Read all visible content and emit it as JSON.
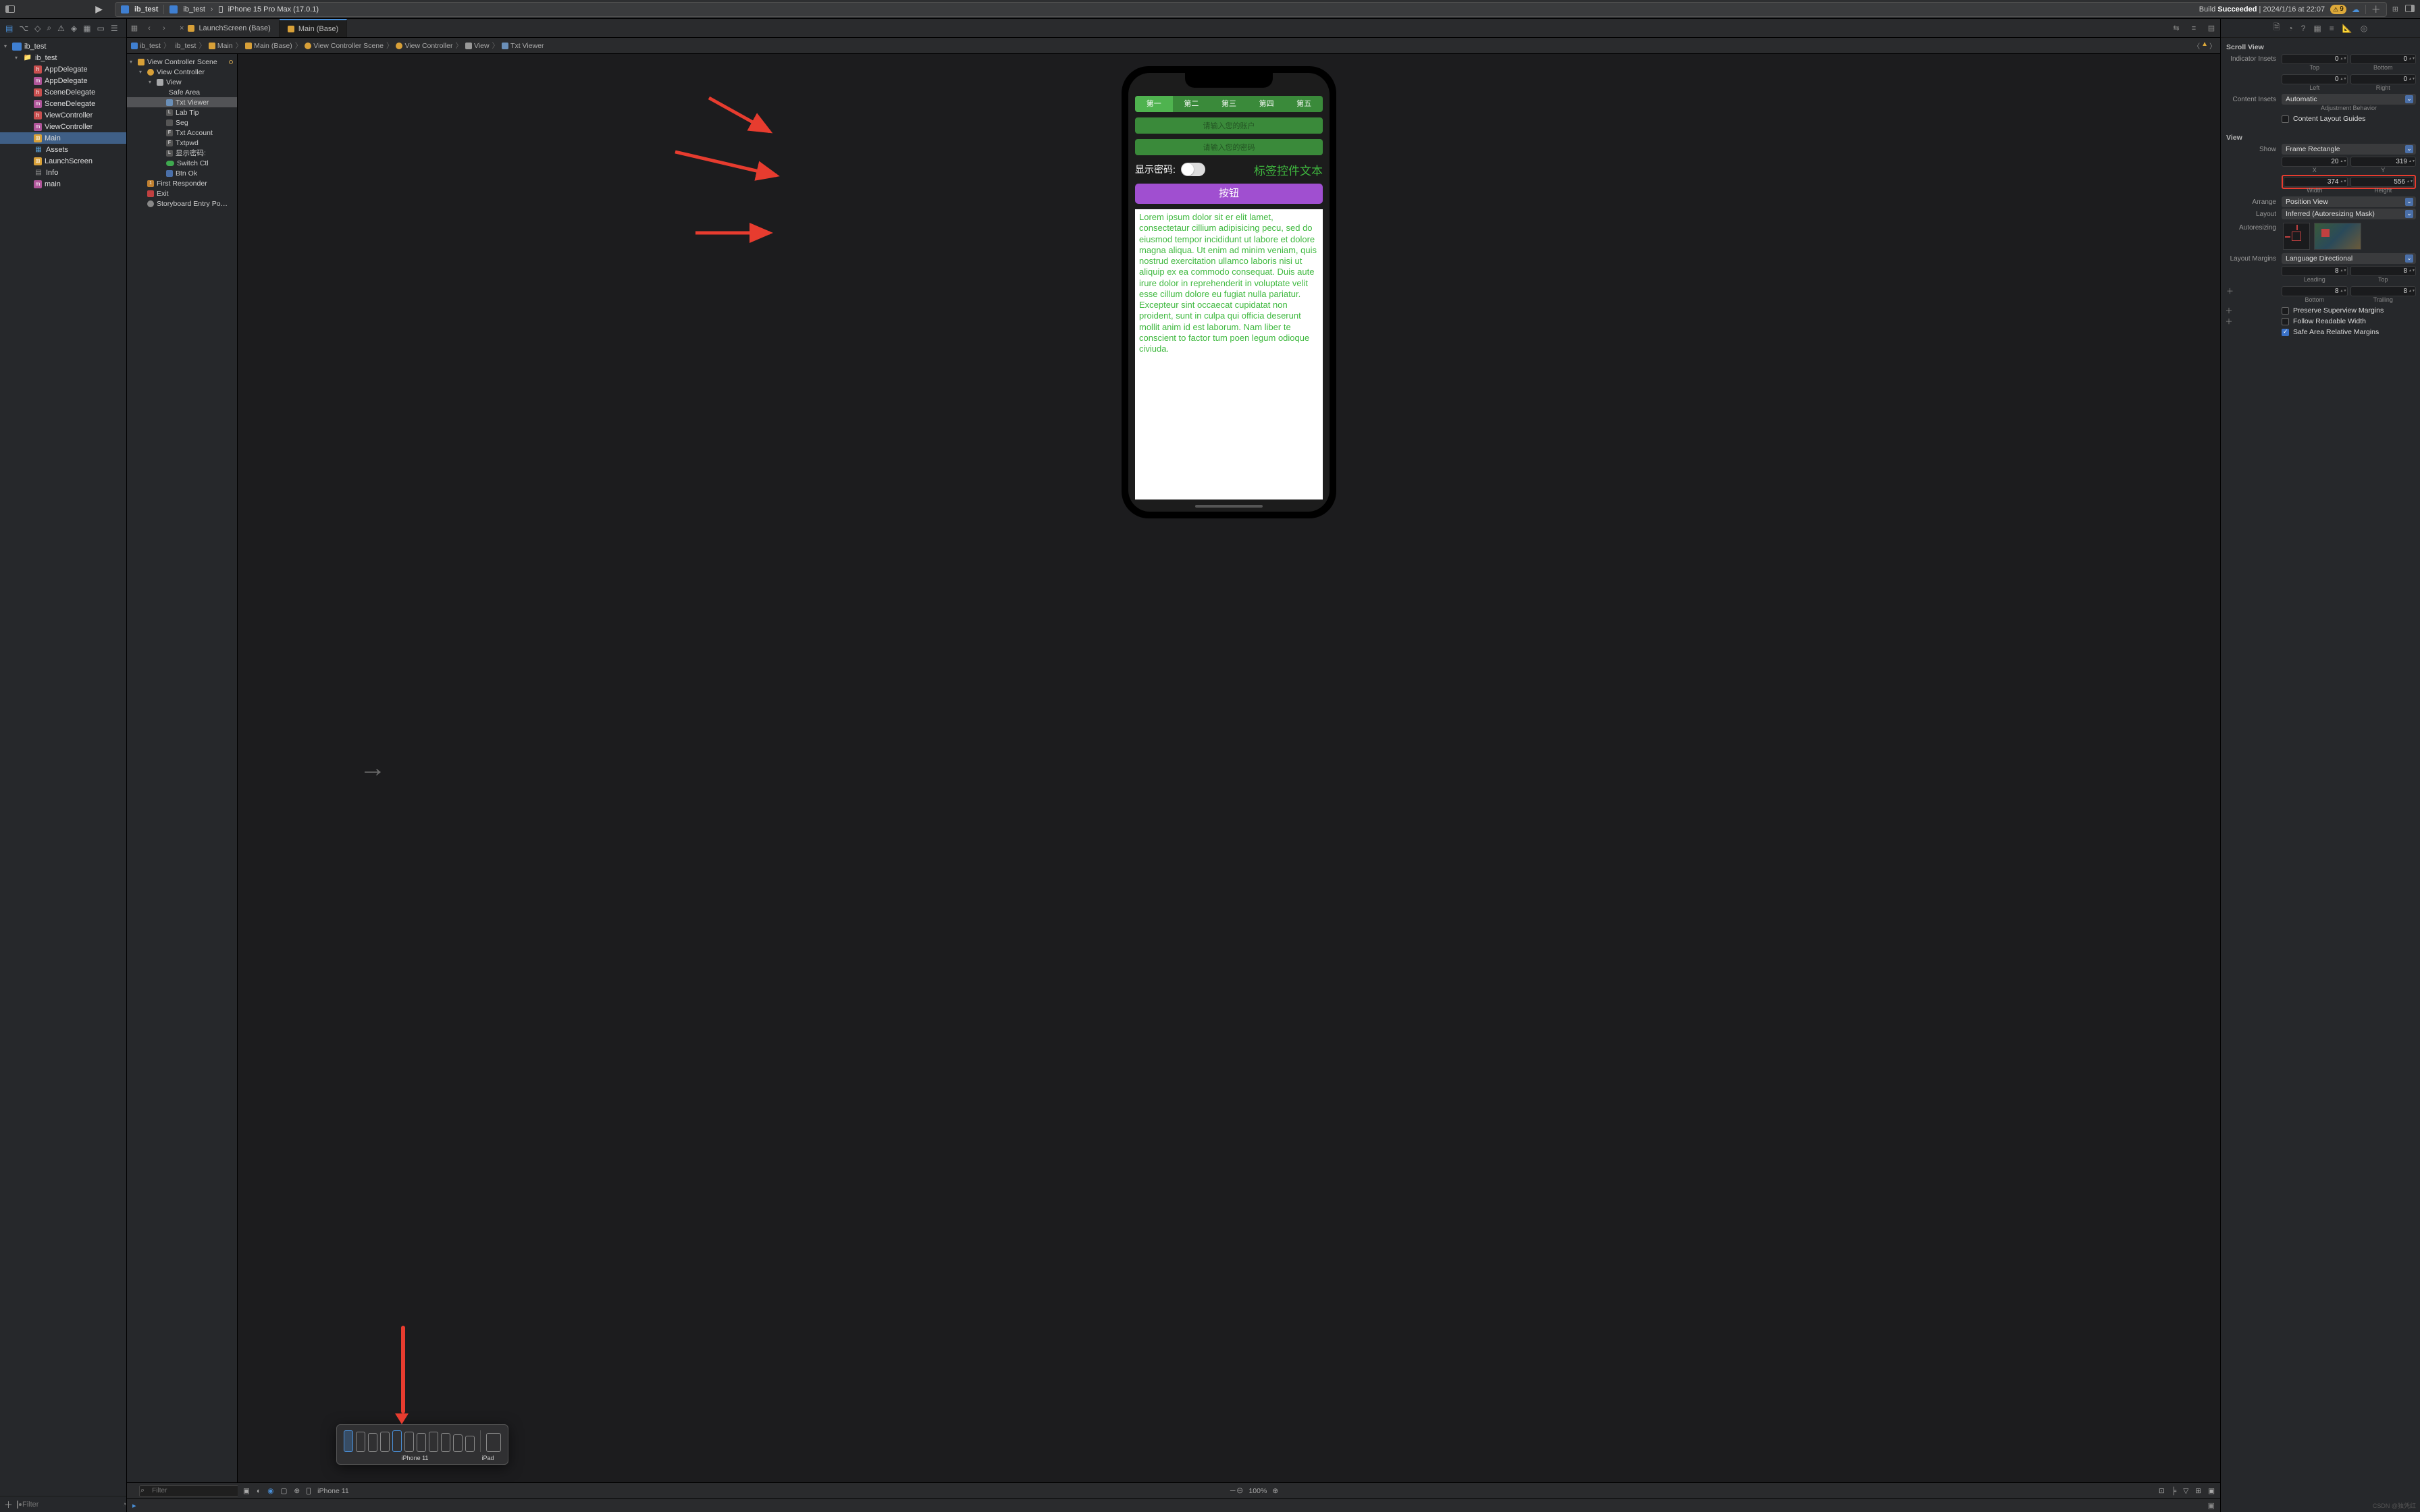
{
  "titlebar": {
    "project": "ib_test",
    "scheme": "ib_test",
    "device": "iPhone 15 Pro Max (17.0.1)",
    "status_prefix": "Build ",
    "status_bold": "Succeeded",
    "status_suffix": " | 2024/1/16 at 22:07",
    "warnings": "9"
  },
  "navigator": {
    "items": [
      {
        "depth": 0,
        "icon": "proj",
        "label": "ib_test",
        "chev": "▾"
      },
      {
        "depth": 1,
        "icon": "folder",
        "label": "ib_test",
        "chev": "▾"
      },
      {
        "depth": 2,
        "icon": "h",
        "label": "AppDelegate"
      },
      {
        "depth": 2,
        "icon": "m",
        "label": "AppDelegate"
      },
      {
        "depth": 2,
        "icon": "h",
        "label": "SceneDelegate"
      },
      {
        "depth": 2,
        "icon": "m",
        "label": "SceneDelegate"
      },
      {
        "depth": 2,
        "icon": "h",
        "label": "ViewController"
      },
      {
        "depth": 2,
        "icon": "m",
        "label": "ViewController"
      },
      {
        "depth": 2,
        "icon": "story",
        "label": "Main",
        "sel": true
      },
      {
        "depth": 2,
        "icon": "assets",
        "label": "Assets"
      },
      {
        "depth": 2,
        "icon": "story",
        "label": "LaunchScreen"
      },
      {
        "depth": 2,
        "icon": "plist",
        "label": "Info"
      },
      {
        "depth": 2,
        "icon": "m",
        "label": "main"
      }
    ],
    "filter_placeholder": "Filter"
  },
  "tabs": [
    {
      "label": "LaunchScreen (Base)",
      "active": false
    },
    {
      "label": "Main (Base)",
      "active": true
    }
  ],
  "jumpbar": [
    "ib_test",
    "ib_test",
    "Main",
    "Main (Base)",
    "View Controller Scene",
    "View Controller",
    "View",
    "Txt Viewer"
  ],
  "outline": [
    {
      "d": 0,
      "icon": "story-ico",
      "label": "View Controller Scene",
      "chev": "▾",
      "ring": true
    },
    {
      "d": 1,
      "icon": "vc-ico",
      "label": "View Controller",
      "chev": "▾"
    },
    {
      "d": 2,
      "icon": "view-ico",
      "label": "View",
      "chev": "▾"
    },
    {
      "d": 3,
      "icon": "safe-ico",
      "label": "Safe Area"
    },
    {
      "d": 3,
      "icon": "txt-ico",
      "label": "Txt Viewer",
      "sel": true
    },
    {
      "d": 3,
      "icon": "lbl-ico",
      "label": "Lab Tip",
      "glyph": "L"
    },
    {
      "d": 3,
      "icon": "seg-ico",
      "label": "Seg"
    },
    {
      "d": 3,
      "icon": "lbl-ico",
      "label": "Txt Account",
      "glyph": "F"
    },
    {
      "d": 3,
      "icon": "lbl-ico",
      "label": "Txtpwd",
      "glyph": "F"
    },
    {
      "d": 3,
      "icon": "lbl-ico",
      "label": "显示密码:",
      "glyph": "L"
    },
    {
      "d": 3,
      "icon": "sw-ico",
      "label": "Switch Ctl"
    },
    {
      "d": 3,
      "icon": "btn-ico",
      "label": "Btn Ok"
    },
    {
      "d": 1,
      "icon": "fr-ico",
      "label": "First Responder",
      "glyph": "1"
    },
    {
      "d": 1,
      "icon": "exit-ico",
      "label": "Exit"
    },
    {
      "d": 1,
      "icon": "entry-ico",
      "label": "Storyboard Entry Po…"
    }
  ],
  "outline_filter_placeholder": "Filter",
  "device_preview": {
    "segments": [
      "第一",
      "第二",
      "第三",
      "第四",
      "第五"
    ],
    "field1": "请输入您的账户",
    "field2": "请输入您的密码",
    "pwd_label": "显示密码:",
    "label_text": "标签控件文本",
    "button": "按钮",
    "lorem": "Lorem ipsum dolor sit er elit lamet, consectetaur cillium adipisicing pecu, sed do eiusmod tempor incididunt ut labore et dolore magna aliqua. Ut enim ad minim veniam, quis nostrud exercitation ullamco laboris nisi ut aliquip ex ea commodo consequat. Duis aute irure dolor in reprehenderit in voluptate velit esse cillum dolore eu fugiat nulla pariatur. Excepteur sint occaecat cupidatat non proident, sunt in culpa qui officia deserunt mollit anim id est laborum. Nam liber te conscient to factor tum poen legum odioque civiuda."
  },
  "device_picker": {
    "label": "iPhone 11",
    "ipad": "iPad"
  },
  "canvas_bottom": {
    "device": "iPhone 11",
    "zoom": "100%"
  },
  "inspector": {
    "scroll_view": "Scroll View",
    "indicator_insets": "Indicator Insets",
    "top": "Top",
    "bottom": "Bottom",
    "left": "Left",
    "right": "Right",
    "insets": {
      "top": "0",
      "bottom": "0",
      "left": "0",
      "right": "0"
    },
    "content_insets_label": "Content Insets",
    "content_insets": "Automatic",
    "adjustment_behavior": "Adjustment Behavior",
    "content_layout_guides": "Content Layout Guides",
    "view_label": "View",
    "show_label": "Show",
    "show": "Frame Rectangle",
    "x": "20",
    "y": "319",
    "x_label": "X",
    "y_label": "Y",
    "w": "374",
    "h": "556",
    "w_label": "Width",
    "h_label": "Height",
    "arrange_label": "Arrange",
    "arrange": "Position View",
    "layout_label": "Layout",
    "layout": "Inferred (Autoresizing Mask)",
    "autoresizing_label": "Autoresizing",
    "layout_margins_label": "Layout Margins",
    "layout_margins": "Language Directional",
    "margins": {
      "leading": "8",
      "top": "8",
      "bottom": "8",
      "trailing": "8"
    },
    "leading": "Leading",
    "trailing": "Trailing",
    "preserve": "Preserve Superview Margins",
    "readable": "Follow Readable Width",
    "safearea": "Safe Area Relative Margins"
  },
  "watermark": "CSDN @独凭红"
}
